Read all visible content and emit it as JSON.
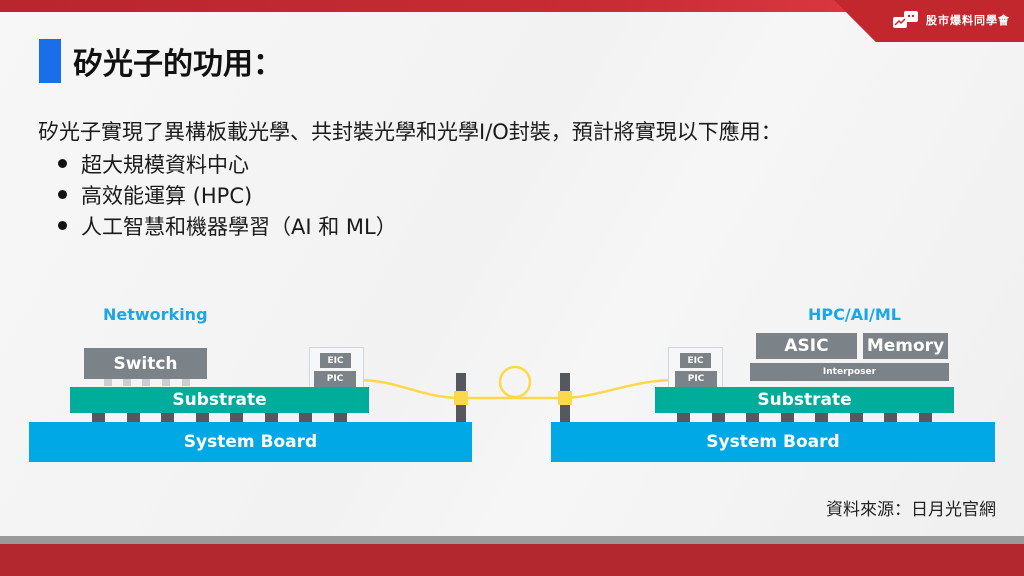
{
  "brand": {
    "name": "股市爆料同學會",
    "icon": "chat-bubbles-chart-icon",
    "colors": {
      "primary_red": "#c1272d",
      "title_marker": "#1a6fe8",
      "diagram_label": "#1ca6e8"
    }
  },
  "slide": {
    "title": "矽光子的功用：",
    "intro": "矽光子實現了異構板載光學、共封裝光學和光學I/O封裝，預計將實現以下應用：",
    "bullets": [
      "超大規模資料中心",
      "高效能運算 (HPC)",
      "人工智慧和機器學習（AI 和 ML）"
    ],
    "source": "資料來源：日月光官網"
  },
  "diagram": {
    "left": {
      "heading": "Networking",
      "chip": "Switch",
      "substrate": "Substrate",
      "board": "System Board",
      "eic": "EIC",
      "pic": "PIC"
    },
    "right": {
      "heading": "HPC/AI/ML",
      "asic": "ASIC",
      "memory": "Memory",
      "interposer": "Interposer",
      "substrate": "Substrate",
      "board": "System Board",
      "eic": "EIC",
      "pic": "PIC"
    },
    "fiber_color": "#ffd84a"
  }
}
